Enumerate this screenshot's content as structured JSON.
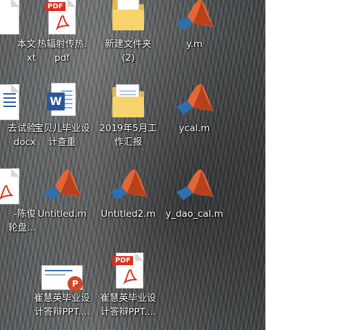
{
  "desktop": {
    "icons": [
      {
        "id": "partial-text",
        "label": "本文\nxt"
      },
      {
        "id": "pdf-heat",
        "label": "热辐射传热.\npdf"
      },
      {
        "id": "new-folder-2",
        "label": "新建文件夹\n(2)"
      },
      {
        "id": "y-m",
        "label": "y.m"
      },
      {
        "id": "partial-docx",
        "label": "去试验\ndocx"
      },
      {
        "id": "baobei",
        "label": "宝贝儿毕业设\n计查重"
      },
      {
        "id": "work-report",
        "label": "2019年5月工\n作汇报"
      },
      {
        "id": "ycal-m",
        "label": "ycal.m"
      },
      {
        "id": "partial-pdf",
        "label": "-陈俊\n轮盘..."
      },
      {
        "id": "untitled-m",
        "label": "Untitled.m"
      },
      {
        "id": "untitled2-m",
        "label": "Untitled2.m"
      },
      {
        "id": "y-dao-cal-m",
        "label": "y_dao_cal.m"
      },
      {
        "id": "ppt-1",
        "label": "崔慧英毕业设\n计答辩PPT...."
      },
      {
        "id": "pdf-2",
        "label": "崔慧英毕业设\n计答辩PPT...."
      }
    ]
  },
  "colors": {
    "pdf_red": "#d7301f",
    "matlab_orange": "#e16737",
    "matlab_blue": "#2f6fb0",
    "folder_yellow": "#f6d36b",
    "word_blue": "#2b579a",
    "ppt_orange": "#d24726"
  },
  "text": {
    "pdf_badge": "PDF",
    "word_badge": "W",
    "ppt_badge": "P"
  }
}
